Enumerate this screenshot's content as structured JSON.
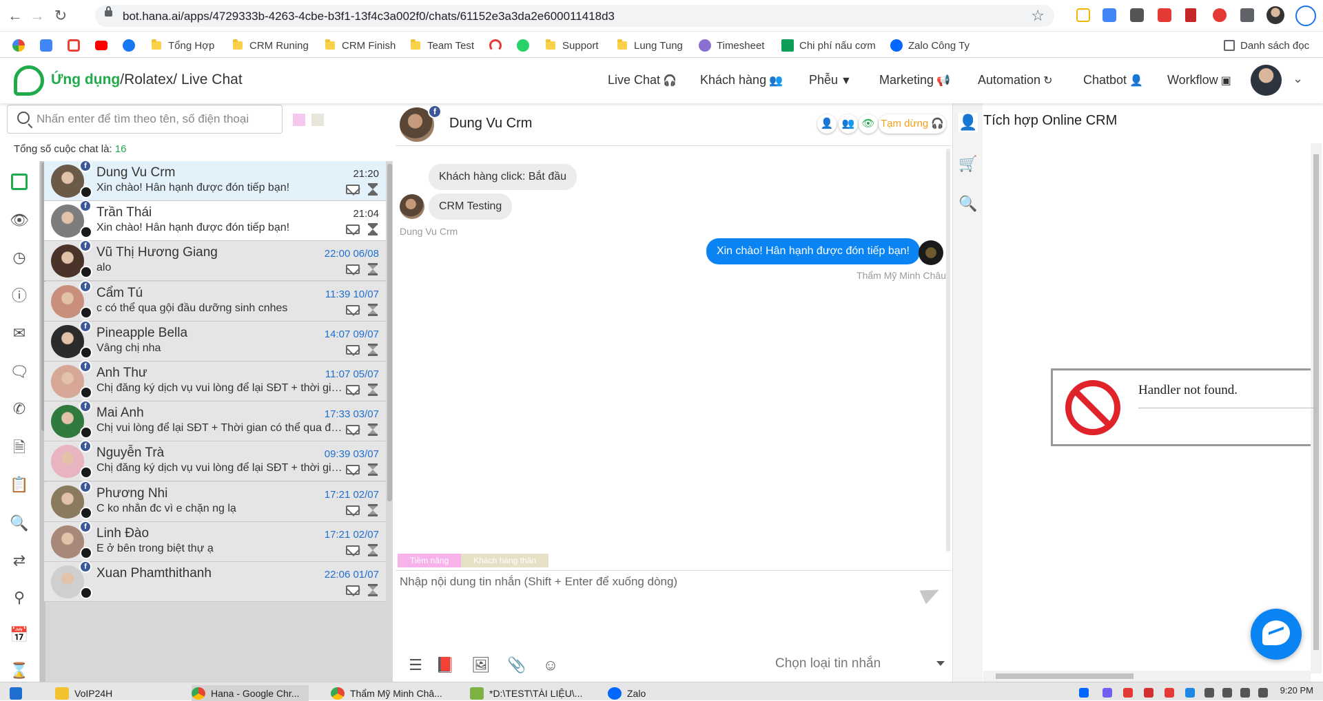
{
  "browser": {
    "url": "bot.hana.ai/apps/4729333b-4263-4cbe-b3f1-13f4c3a002f0/chats/61152e3a3da2e600011418d3",
    "bookmarks": [
      "Tổng Hợp",
      "CRM Runing",
      "CRM Finish",
      "Team Test",
      "Support",
      "Lung Tung",
      "Timesheet",
      "Chi phí nấu cơm",
      "Zalo Công Ty"
    ],
    "reading_list": "Danh sách đọc"
  },
  "app": {
    "breadcrumb_first": "Ứng dụng",
    "breadcrumb_rest": "/Rolatex/ Live Chat",
    "nav": [
      "Live Chat",
      "Khách hàng",
      "Phễu",
      "Marketing",
      "Automation",
      "Chatbot",
      "Workflow"
    ]
  },
  "sidebar": {
    "search_placeholder": "Nhấn enter để tìm theo tên, số điện thoại",
    "total_label": "Tổng số cuộc chat là: ",
    "total_count": "16",
    "filter_colors": [
      "#f6c8ef",
      "#e8e6d8"
    ]
  },
  "chats": [
    {
      "name": "Dung Vu Crm",
      "message": "Xin chào! Hân hạnh được đón tiếp bạn!",
      "time": "21:20",
      "state": "active"
    },
    {
      "name": "Trần Thái",
      "message": "Xin chào! Hân hạnh được đón tiếp bạn!",
      "time": "21:04",
      "state": "plain"
    },
    {
      "name": "Vũ Thị Hương Giang",
      "message": "alo",
      "time": "22:00 06/08",
      "state": "grey"
    },
    {
      "name": "Cẩm Tú",
      "message": "c có thể qua gội đầu dưỡng sinh cnhes",
      "time": "11:39 10/07",
      "state": "grey"
    },
    {
      "name": "Pineapple Bella",
      "message": "Vâng chị nha",
      "time": "14:07 09/07",
      "state": "grey"
    },
    {
      "name": "Anh Thư",
      "message": "Chị đăng ký dịch vụ vui lòng để lại SĐT + thời gian có thể qua để được tư vấn",
      "time": "11:07 05/07",
      "state": "grey"
    },
    {
      "name": "Mai Anh",
      "message": "Chị vui lòng để lại SĐT + Thời gian có thể qua để được tư vấn",
      "time": "17:33 03/07",
      "state": "grey"
    },
    {
      "name": "Nguyễn Trà",
      "message": "Chị đăng ký dịch vụ vui lòng để lại SĐT + thời gian có thể qua để được tư vấn",
      "time": "09:39 03/07",
      "state": "grey"
    },
    {
      "name": "Phương Nhi",
      "message": "C ko nhắn đc vì e chặn ng lạ",
      "time": "17:21 02/07",
      "state": "grey"
    },
    {
      "name": "Linh Đào",
      "message": "E ở bên trong biệt thự ạ",
      "time": "17:21 02/07",
      "state": "grey"
    },
    {
      "name": "Xuan Phamthithanh",
      "message": "",
      "time": "22:06 01/07",
      "state": "grey"
    }
  ],
  "conversation": {
    "contact_name": "Dung Vu Crm",
    "pause_label": "Tạm dừng",
    "messages": [
      {
        "direction": "in",
        "text": "Khách hàng click: Bắt đầu"
      },
      {
        "direction": "in",
        "text": "CRM Testing"
      },
      {
        "direction": "out",
        "text": "Xin chào! Hân hạnh được đón tiếp bạn!"
      }
    ],
    "in_sender": "Dung Vu Crm",
    "out_sender": "Thẩm Mỹ Minh Châu",
    "tags": [
      {
        "label": "Tiềm năng",
        "color": "#f7b2ec"
      },
      {
        "label": "Khách hàng thân",
        "color": "#e6e1c6"
      }
    ],
    "composer_placeholder": "Nhập nội dung tin nhắn (Shift + Enter để xuống dòng)",
    "message_type_label": "Chọn loại tin nhắn"
  },
  "right_panel": {
    "title": "Tích hợp Online CRM",
    "error_text": "Handler not found."
  },
  "taskbar": {
    "items": [
      "VoIP24H",
      "Hana - Google Chr...",
      "Thẩm Mỹ Minh Châ...",
      "*D:\\TEST\\TÀI LIỆU\\...",
      "Zalo"
    ],
    "clock": "9:20 PM"
  },
  "colors": {
    "brand": "#1faa4b",
    "outgoing_bubble": "#0b84f3",
    "date_blue": "#1f6fd1",
    "pause_orange": "#f0a21a"
  }
}
